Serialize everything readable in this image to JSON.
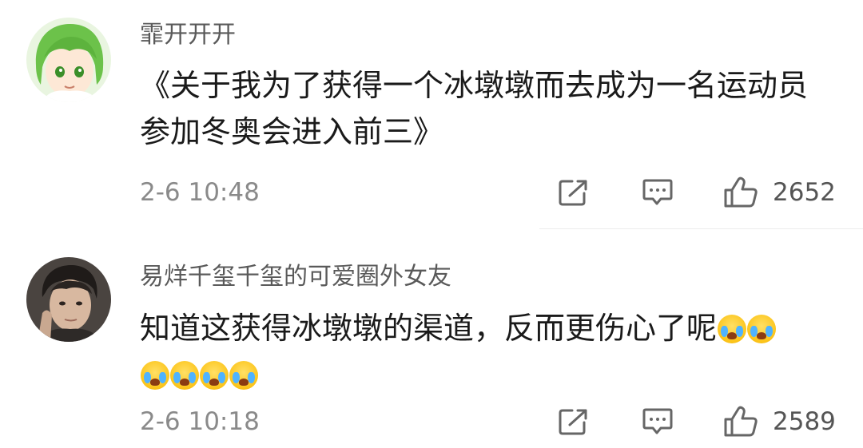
{
  "comments": [
    {
      "username": "霏开开开",
      "text": "《关于我为了获得一个冰墩墩而去成为一名运动员参加冬奥会进入前三》",
      "emojis": [],
      "time": "2-6 10:48",
      "likes": "2652",
      "avatar_icon": "green-haired-anime-avatar"
    },
    {
      "username": "易烊千玺千玺的可爱圈外女友",
      "text": "知道这获得冰墩墩的渠道，反而更伤心了呢",
      "emojis": [
        "crying-face",
        "crying-face",
        "crying-face",
        "crying-face",
        "crying-face",
        "crying-face"
      ],
      "time": "2-6 10:18",
      "likes": "2589",
      "avatar_icon": "person-photo-avatar"
    }
  ],
  "colors": {
    "username": "#5a5a5a",
    "text": "#1a1a1a",
    "meta": "#8a8a8a",
    "icon": "#666666"
  }
}
